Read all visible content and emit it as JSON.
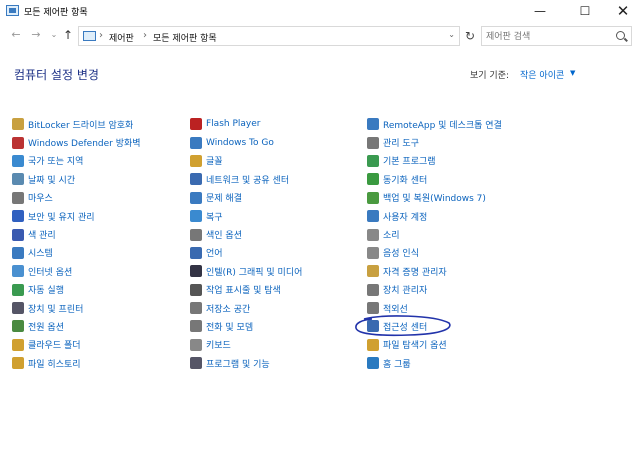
{
  "window": {
    "title": "모든 제어판 항목",
    "minimize": "—",
    "maximize": "☐",
    "close": "✕"
  },
  "nav": {
    "back": "←",
    "forward": "→",
    "dropdown": "⌄",
    "up": "↑",
    "refresh": "↻"
  },
  "address": {
    "crumbs": [
      "제어판",
      "모든 제어판 항목"
    ],
    "sep": "›",
    "dropdown": "⌄"
  },
  "search": {
    "placeholder": "제어판 검색"
  },
  "header": {
    "title": "컴퓨터 설정 변경",
    "view_label": "보기 기준:",
    "view_value": "작은 아이콘",
    "view_caret": "▼"
  },
  "columns": [
    [
      {
        "label": "BitLocker 드라이브 암호화",
        "icon": "bitlocker-icon",
        "color": "#c8a040"
      },
      {
        "label": "Windows Defender 방화벽",
        "icon": "firewall-icon",
        "color": "#b33"
      },
      {
        "label": "국가 또는 지역",
        "icon": "region-icon",
        "color": "#3a8ad0"
      },
      {
        "label": "날짜 및 시간",
        "icon": "clock-icon",
        "color": "#5a8ab0"
      },
      {
        "label": "마우스",
        "icon": "mouse-icon",
        "color": "#777"
      },
      {
        "label": "보안 및 유지 관리",
        "icon": "flag-icon",
        "color": "#3060c0"
      },
      {
        "label": "색 관리",
        "icon": "color-management-icon",
        "color": "#3a5ab0"
      },
      {
        "label": "시스템",
        "icon": "system-icon",
        "color": "#3a7ac0"
      },
      {
        "label": "인터넷 옵션",
        "icon": "internet-options-icon",
        "color": "#4a90d0"
      },
      {
        "label": "자동 실행",
        "icon": "autoplay-icon",
        "color": "#3a9a50"
      },
      {
        "label": "장치 및 프린터",
        "icon": "printer-icon",
        "color": "#556"
      },
      {
        "label": "전원 옵션",
        "icon": "power-icon",
        "color": "#4a8a40"
      },
      {
        "label": "클라우드 폴더",
        "icon": "cloud-folder-icon",
        "color": "#d0a030"
      },
      {
        "label": "파일 히스토리",
        "icon": "file-history-icon",
        "color": "#d0a030"
      }
    ],
    [
      {
        "label": "Flash Player",
        "icon": "flash-icon",
        "color": "#b22"
      },
      {
        "label": "Windows To Go",
        "icon": "windows-to-go-icon",
        "color": "#3a7ac0"
      },
      {
        "label": "글꼴",
        "icon": "font-icon",
        "color": "#d0a030"
      },
      {
        "label": "네트워크 및 공유 센터",
        "icon": "network-icon",
        "color": "#3a6ab0"
      },
      {
        "label": "문제 해결",
        "icon": "troubleshoot-icon",
        "color": "#3a7ac0"
      },
      {
        "label": "복구",
        "icon": "recovery-icon",
        "color": "#3a8ad0"
      },
      {
        "label": "색인 옵션",
        "icon": "indexing-icon",
        "color": "#777"
      },
      {
        "label": "언어",
        "icon": "language-icon",
        "color": "#3a6ab0"
      },
      {
        "label": "인텔(R) 그래픽 및 미디어",
        "icon": "intel-graphics-icon",
        "color": "#334"
      },
      {
        "label": "작업 표시줄 및 탐색",
        "icon": "taskbar-icon",
        "color": "#555"
      },
      {
        "label": "저장소 공간",
        "icon": "storage-icon",
        "color": "#777"
      },
      {
        "label": "전화 및 모뎀",
        "icon": "phone-modem-icon",
        "color": "#777"
      },
      {
        "label": "키보드",
        "icon": "keyboard-icon",
        "color": "#888"
      },
      {
        "label": "프로그램 및 기능",
        "icon": "programs-icon",
        "color": "#556"
      }
    ],
    [
      {
        "label": "RemoteApp 및 데스크톱 연결",
        "icon": "remoteapp-icon",
        "color": "#3a7ac0"
      },
      {
        "label": "관리 도구",
        "icon": "admin-tools-icon",
        "color": "#777"
      },
      {
        "label": "기본 프로그램",
        "icon": "default-programs-icon",
        "color": "#3a9a50"
      },
      {
        "label": "동기화 센터",
        "icon": "sync-center-icon",
        "color": "#3a9a40"
      },
      {
        "label": "백업 및 복원(Windows 7)",
        "icon": "backup-icon",
        "color": "#4a9a40"
      },
      {
        "label": "사용자 계정",
        "icon": "user-accounts-icon",
        "color": "#3a7ac0"
      },
      {
        "label": "소리",
        "icon": "sound-icon",
        "color": "#888"
      },
      {
        "label": "음성 인식",
        "icon": "speech-icon",
        "color": "#888"
      },
      {
        "label": "자격 증명 관리자",
        "icon": "credential-icon",
        "color": "#c8a040"
      },
      {
        "label": "장치 관리자",
        "icon": "device-manager-icon",
        "color": "#777"
      },
      {
        "label": "적외선",
        "icon": "infrared-icon",
        "color": "#777"
      },
      {
        "label": "접근성 센터",
        "icon": "ease-of-access-icon",
        "color": "#3a6ab0"
      },
      {
        "label": "파일 탐색기 옵션",
        "icon": "explorer-options-icon",
        "color": "#d0a030"
      },
      {
        "label": "홈 그룹",
        "icon": "homegroup-icon",
        "color": "#2a7ac0"
      }
    ]
  ]
}
